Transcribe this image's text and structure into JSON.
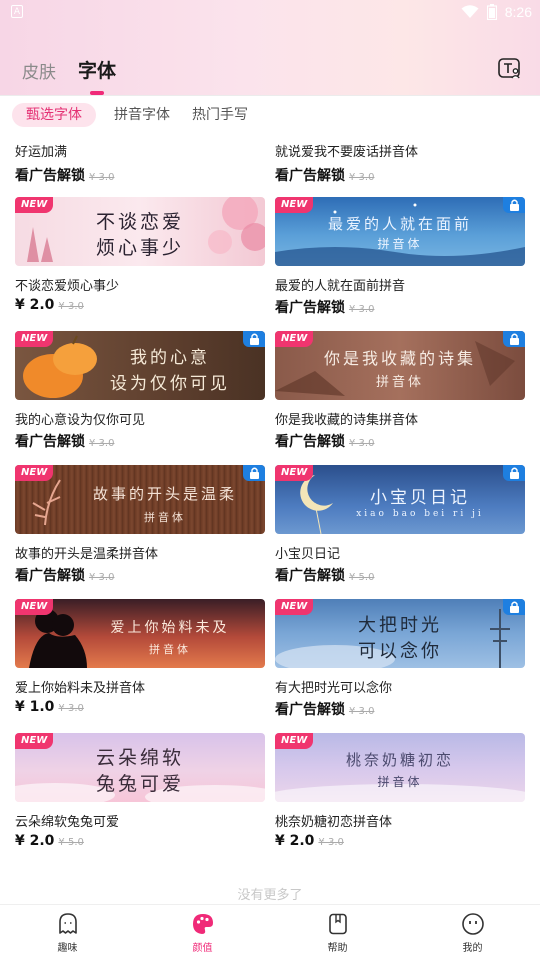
{
  "status": {
    "app_glyph": "A",
    "time": "8:26",
    "icons": [
      "wifi-icon",
      "battery-icon"
    ]
  },
  "header": {
    "tabs": [
      {
        "label": "皮肤",
        "active": false
      },
      {
        "label": "字体",
        "active": true
      }
    ],
    "action_icon": "user-font-icon",
    "accent_color": "#f02a78"
  },
  "subtabs": [
    {
      "label": "甄选字体",
      "active": true
    },
    {
      "label": "拼音字体",
      "active": false
    },
    {
      "label": "热门手写",
      "active": false
    }
  ],
  "fonts": [
    {
      "name": "好运加满",
      "price": "看广告解锁",
      "old_price": "¥ 3.0",
      "new": false,
      "locked": false
    },
    {
      "name": "就说爱我不要废话拼音体",
      "price": "看广告解锁",
      "old_price": "¥ 3.0",
      "new": false,
      "locked": false
    },
    {
      "name": "不谈恋爱烦心事少",
      "price": "¥ 2.0",
      "old_price": "¥ 3.0",
      "new": true,
      "locked": false,
      "preview_lines": [
        "不谈恋爱",
        "烦心事少"
      ]
    },
    {
      "name": "最爱的人就在面前拼音",
      "price": "看广告解锁",
      "old_price": "¥ 3.0",
      "new": true,
      "locked": true,
      "preview_lines": [
        "最爱的人就在面前",
        "拼音体"
      ]
    },
    {
      "name": "我的心意设为仅你可见",
      "price": "看广告解锁",
      "old_price": "¥ 3.0",
      "new": true,
      "locked": true,
      "preview_lines": [
        "我的心意",
        "设为仅你可见"
      ]
    },
    {
      "name": "你是我收藏的诗集拼音体",
      "price": "看广告解锁",
      "old_price": "¥ 3.0",
      "new": true,
      "locked": true,
      "preview_lines": [
        "你是我收藏的诗集",
        "拼音体"
      ]
    },
    {
      "name": "故事的开头是温柔拼音体",
      "price": "看广告解锁",
      "old_price": "¥ 3.0",
      "new": true,
      "locked": true,
      "preview_lines": [
        "故事的开头是温柔",
        "拼音体"
      ]
    },
    {
      "name": "小宝贝日记",
      "price": "看广告解锁",
      "old_price": "¥ 5.0",
      "new": true,
      "locked": true,
      "preview_lines": [
        "小宝贝日记",
        "xiao bao bei ri ji"
      ]
    },
    {
      "name": "爱上你始料未及拼音体",
      "price": "¥ 1.0",
      "old_price": "¥ 3.0",
      "new": true,
      "locked": false,
      "preview_lines": [
        "爱上你始料未及",
        "拼音体"
      ]
    },
    {
      "name": "有大把时光可以念你",
      "price": "看广告解锁",
      "old_price": "¥ 3.0",
      "new": true,
      "locked": true,
      "preview_lines": [
        "大把时光",
        "可以念你"
      ]
    },
    {
      "name": "云朵绵软兔兔可爱",
      "price": "¥ 2.0",
      "old_price": "¥ 5.0",
      "new": true,
      "locked": false,
      "preview_lines": [
        "云朵绵软",
        "兔兔可爱"
      ]
    },
    {
      "name": "桃奈奶糖初恋拼音体",
      "price": "¥ 2.0",
      "old_price": "¥ 3.0",
      "new": true,
      "locked": false,
      "preview_lines": [
        "桃奈奶糖初恋",
        "拼音体"
      ]
    }
  ],
  "badges": {
    "new_label": "NEW",
    "lock_icon": "lock-icon"
  },
  "footer_text": "没有更多了",
  "bottom_nav": [
    {
      "label": "趣味",
      "icon": "ghost-icon",
      "active": false
    },
    {
      "label": "颜值",
      "icon": "palette-icon",
      "active": true
    },
    {
      "label": "帮助",
      "icon": "help-book-icon",
      "active": false
    },
    {
      "label": "我的",
      "icon": "smiley-icon",
      "active": false
    }
  ]
}
